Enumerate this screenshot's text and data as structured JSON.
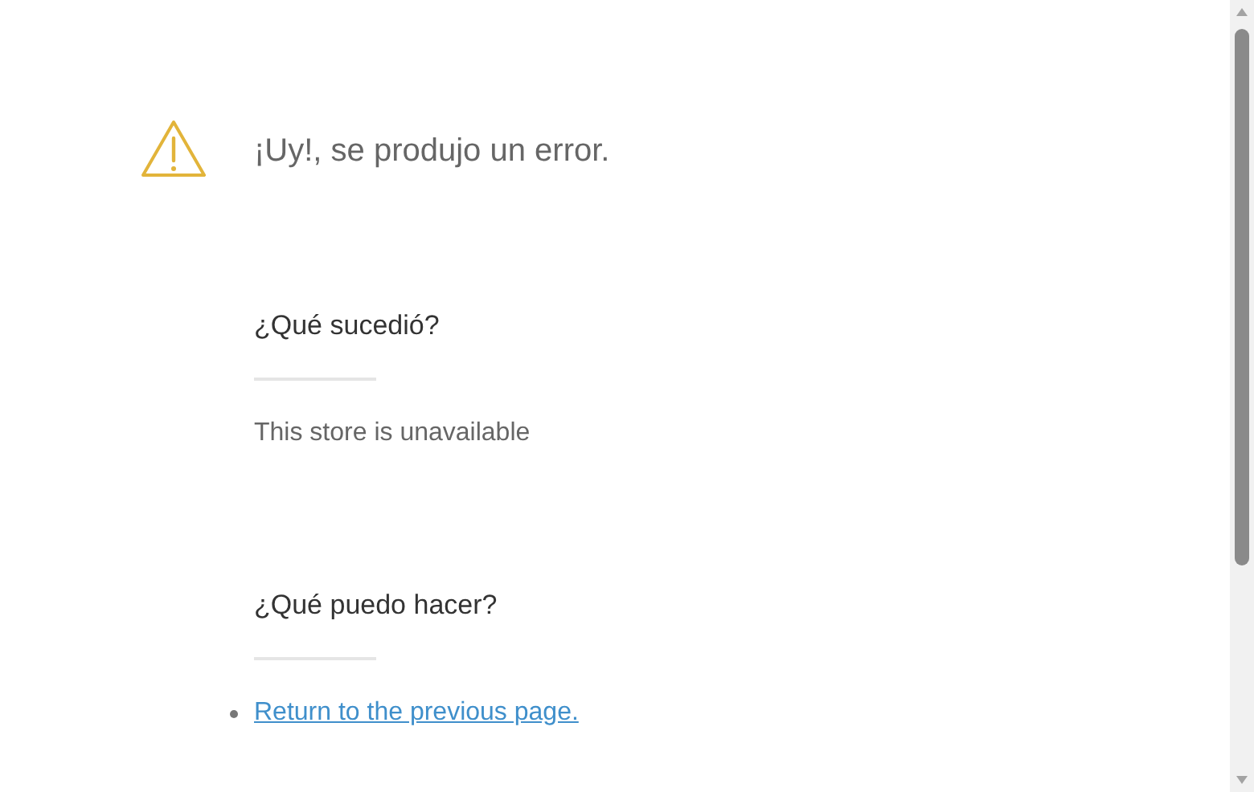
{
  "header": {
    "title": "¡Uy!, se produjo un error."
  },
  "sections": [
    {
      "heading": "¿Qué sucedió?",
      "body": "This store is unavailable"
    },
    {
      "heading": "¿Qué puedo hacer?",
      "links": [
        "Return to the previous page."
      ]
    }
  ]
}
